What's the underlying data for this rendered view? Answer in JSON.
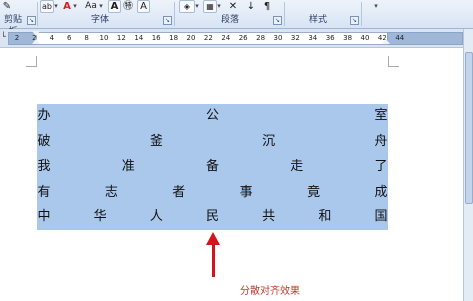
{
  "ribbon": {
    "tools": {
      "format_painter_dd": "▾",
      "font_color_a": "A",
      "font_color_dd": "▾",
      "change_case": "Aa",
      "change_case_dd": "▾",
      "char_shading": "A",
      "enclose_char": "㊕",
      "phonetic": "A",
      "para_dd": "▾",
      "border_dd": "▾",
      "sort": "↓",
      "para_mark": "¶",
      "styles_dd": "▾"
    },
    "groups": {
      "clipboard": "剪贴板",
      "font": "字体",
      "paragraph": "段落",
      "styles": "样式"
    },
    "launcher_glyph": "↘"
  },
  "ruler": {
    "ticks": [
      "2",
      "2",
      "4",
      "6",
      "8",
      "10",
      "12",
      "14",
      "16",
      "18",
      "20",
      "22",
      "24",
      "26",
      "28",
      "30",
      "32",
      "34",
      "36",
      "38",
      "40",
      "42",
      "44"
    ]
  },
  "document": {
    "lines": [
      [
        "办",
        "公",
        "室"
      ],
      [
        "破",
        "釜",
        "沉",
        "舟"
      ],
      [
        "我",
        "准",
        "备",
        "走",
        "了"
      ],
      [
        "有",
        "志",
        "者",
        "事",
        "竟",
        "成"
      ],
      [
        "中",
        "华",
        "人",
        "民",
        "共",
        "和",
        "国"
      ]
    ]
  },
  "annotation": {
    "caption": "分散对齐效果",
    "arrow_color": "#d4141c"
  },
  "colors": {
    "selection": "#a9c8ec",
    "ribbon": "#d7e4f4"
  }
}
